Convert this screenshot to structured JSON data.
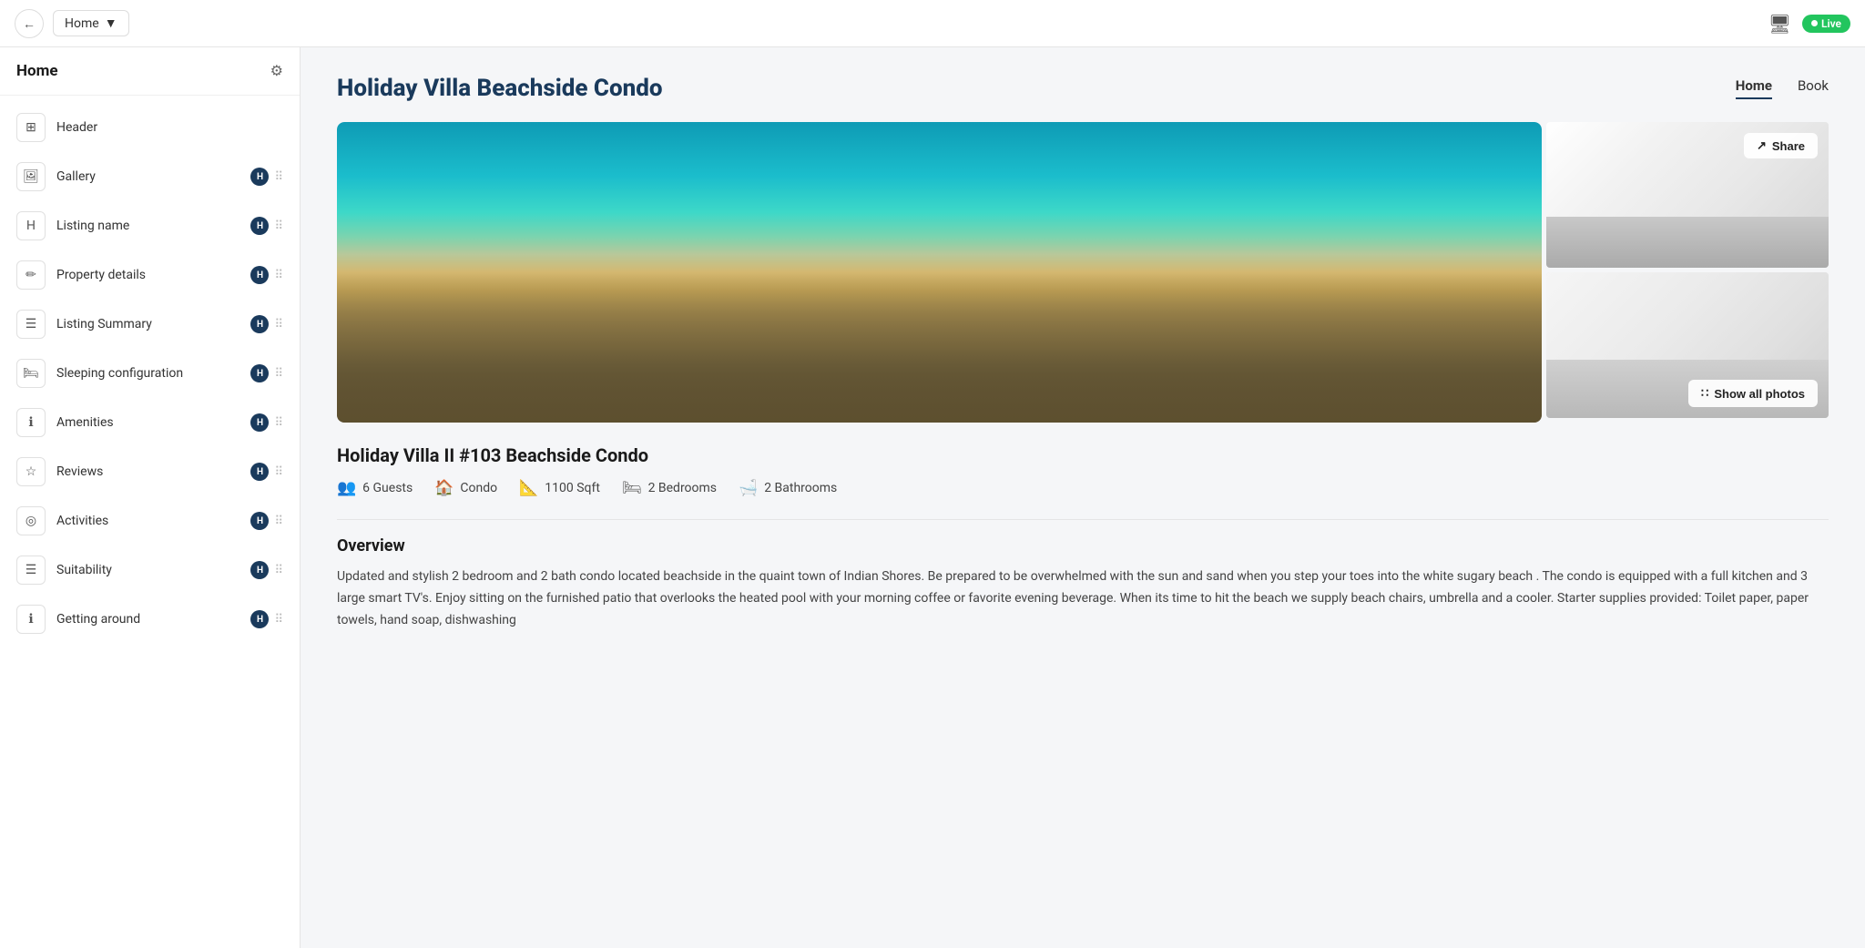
{
  "topbar": {
    "back_label": "←",
    "dropdown_label": "Home",
    "dropdown_icon": "▾",
    "monitor_icon": "🖥",
    "live_label": "Live"
  },
  "sidebar": {
    "title": "Home",
    "gear_icon": "⚙",
    "items": [
      {
        "id": "header",
        "icon": "⊞",
        "label": "Header",
        "has_badge": false
      },
      {
        "id": "gallery",
        "icon": "🖼",
        "label": "Gallery",
        "has_badge": true
      },
      {
        "id": "listing-name",
        "icon": "H",
        "label": "Listing name",
        "has_badge": true
      },
      {
        "id": "property-details",
        "icon": "✏",
        "label": "Property details",
        "has_badge": true
      },
      {
        "id": "listing-summary",
        "icon": "☰",
        "label": "Listing Summary",
        "has_badge": true
      },
      {
        "id": "sleeping-configuration",
        "icon": "🛏",
        "label": "Sleeping configuration",
        "has_badge": true
      },
      {
        "id": "amenities",
        "icon": "ℹ",
        "label": "Amenities",
        "has_badge": true
      },
      {
        "id": "reviews",
        "icon": "☆",
        "label": "Reviews",
        "has_badge": true
      },
      {
        "id": "activities",
        "icon": "◎",
        "label": "Activities",
        "has_badge": true
      },
      {
        "id": "suitability",
        "icon": "☰",
        "label": "Suitability",
        "has_badge": true
      },
      {
        "id": "getting-around",
        "icon": "ℹ",
        "label": "Getting around",
        "has_badge": true
      }
    ]
  },
  "page": {
    "title": "Holiday Villa Beachside Condo",
    "nav": [
      {
        "id": "home",
        "label": "Home",
        "active": true
      },
      {
        "id": "book",
        "label": "Book",
        "active": false
      }
    ],
    "share_label": "Share",
    "show_all_label": "Show all photos",
    "listing_name": "Holiday Villa II #103 Beachside Condo",
    "stats": [
      {
        "id": "guests",
        "icon": "👥",
        "value": "6 Guests"
      },
      {
        "id": "type",
        "icon": "🏠",
        "value": "Condo"
      },
      {
        "id": "sqft",
        "icon": "📐",
        "value": "1100 Sqft"
      },
      {
        "id": "bedrooms",
        "icon": "🛏",
        "value": "2 Bedrooms"
      },
      {
        "id": "bathrooms",
        "icon": "🛁",
        "value": "2 Bathrooms"
      }
    ],
    "overview_title": "Overview",
    "overview_text": "Updated and stylish 2 bedroom and 2 bath condo located beachside in the quaint town of Indian Shores. Be prepared to be overwhelmed with the sun and sand when you step your toes into the white sugary beach . The condo is equipped with a full kitchen and 3 large smart TV's. Enjoy sitting on the furnished patio that overlooks the heated pool with your morning coffee or favorite evening beverage. When its time to hit the beach we supply beach chairs, umbrella and a cooler. Starter supplies provided: Toilet paper, paper towels, hand soap, dishwashing"
  }
}
